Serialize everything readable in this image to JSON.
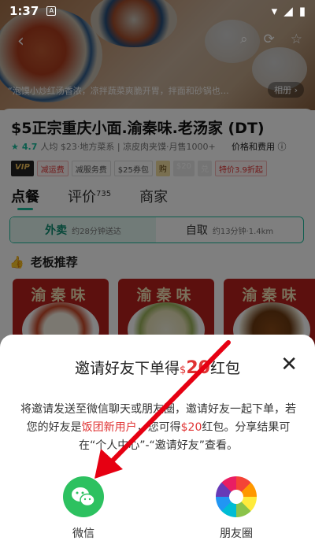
{
  "status": {
    "time": "1:37",
    "notif": "A"
  },
  "hero": {
    "caption": "“泡馍小炒红汤香浓，凉拌蔬菜爽脆开胃，拌面和砂锅也…",
    "album_btn": "相册 ›"
  },
  "store": {
    "name": "$5正宗重庆小面.渝秦味.老汤家 (DT)",
    "rating": "4.7",
    "meta": "人均 $23·地方菜系 | 凉皮肉夹馍·月售1000+",
    "fee_label": "价格和费用 ⓘ"
  },
  "tags": {
    "vip": "VIP",
    "t1": "减运费",
    "t2": "减服务费",
    "t3": "$25券包",
    "t4": "购",
    "t5": "$20",
    "t6": "兑",
    "t7": "特价3.9折起"
  },
  "tabs": {
    "order": "点餐",
    "review": "评价",
    "review_count": "735",
    "merchant": "商家"
  },
  "delivery": {
    "takeout": "外卖",
    "takeout_time": "约28分钟送达",
    "pickup": "自取",
    "pickup_info": "约13分钟·1.4km"
  },
  "rec": {
    "title": "老板推荐",
    "card_title": "渝秦味"
  },
  "sheet": {
    "title_prefix": "邀请好友下单得",
    "currency": "$",
    "amount": "20",
    "title_suffix": "红包",
    "desc_1": "将邀请发送至微信聊天或朋友圈，邀请好友一起下单，若您的好友是",
    "desc_hl1": "饭团新用户",
    "desc_2": "，您可得",
    "desc_hl2": "$20",
    "desc_3": "红包。分享结果可在“个人中心”-“邀请好友”查看。",
    "wechat": "微信",
    "moments": "朋友圈"
  },
  "colors": {
    "accent": "#1abc9c",
    "red": "#e03333",
    "wechat": "#2dc160"
  }
}
